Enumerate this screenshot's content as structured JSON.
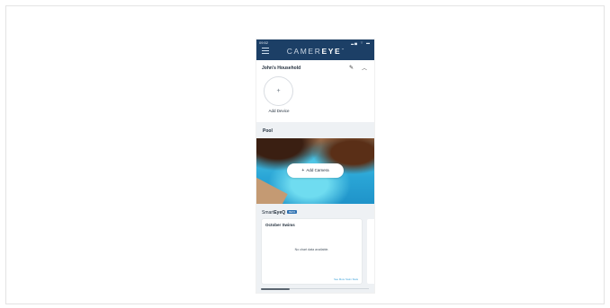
{
  "status_bar": {
    "time": "09:52",
    "icons": "▂▄ ⌔ ▬"
  },
  "app": {
    "brand_light": "CAMER",
    "brand_bold": "EYE",
    "brand_mark": "™"
  },
  "household": {
    "title": "John's Household",
    "add_device_symbol": "+",
    "add_device_label": "Add Device"
  },
  "pool": {
    "title": "Pool",
    "add_camera_symbol": "+",
    "add_camera_label": "Add Camera"
  },
  "smart": {
    "title_light": "Smart",
    "title_bold": "EyeQ",
    "badge": "BETA",
    "card": {
      "title": "October Swims",
      "empty_text": "No chart data available.",
      "link": "See More Swim Stats"
    },
    "carousel_position": 0.27
  },
  "colors": {
    "appbar": "#1c3f66",
    "accent": "#3aa0d8",
    "section_bg": "#eef1f4"
  }
}
